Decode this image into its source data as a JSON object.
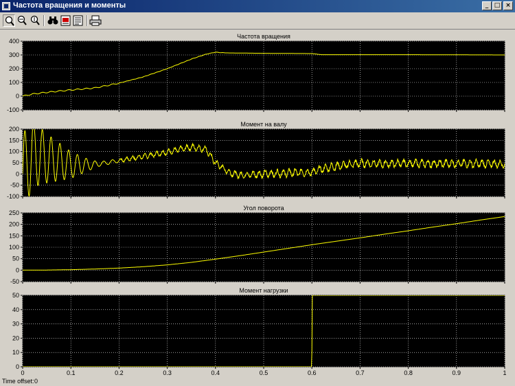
{
  "window": {
    "title": "Частота вращения и моменты",
    "minimize_icon": "minimize-icon",
    "maximize_icon": "maximize-icon",
    "close_icon": "close-icon"
  },
  "toolbar": {
    "tools": [
      "zoom-icon",
      "zoom-x-icon",
      "zoom-y-icon",
      "autoscale-binoculars-icon",
      "save-axes-settings-icon",
      "restore-axes-settings-icon",
      "print-icon"
    ]
  },
  "status": {
    "time_offset_label": "Time offset:",
    "time_offset_value": "0"
  },
  "colors": {
    "plot_background": "#000000",
    "signal": "#ffff00",
    "grid": "#ffffff",
    "figure_background": "#d4d0c8"
  },
  "chart_data": [
    {
      "type": "line",
      "title": "Частота вращения",
      "xlim": [
        0,
        1
      ],
      "ylim": [
        -100,
        400
      ],
      "xticks": [
        0,
        0.1,
        0.2,
        0.3,
        0.4,
        0.5,
        0.6,
        0.7,
        0.8,
        0.9,
        1
      ],
      "yticks": [
        -100,
        0,
        100,
        200,
        300,
        400
      ],
      "grid": true,
      "x": [
        0,
        0.02,
        0.05,
        0.1,
        0.15,
        0.2,
        0.25,
        0.3,
        0.35,
        0.38,
        0.4,
        0.42,
        0.5,
        0.6,
        0.62,
        0.7,
        0.8,
        0.9,
        1.0
      ],
      "y": [
        0,
        15,
        28,
        45,
        60,
        95,
        140,
        200,
        270,
        305,
        320,
        315,
        312,
        310,
        302,
        302,
        302,
        301,
        300
      ]
    },
    {
      "type": "line",
      "title": "Момент на валу",
      "xlim": [
        0,
        1
      ],
      "ylim": [
        -100,
        200
      ],
      "xticks": [
        0,
        0.1,
        0.2,
        0.3,
        0.4,
        0.5,
        0.6,
        0.7,
        0.8,
        0.9,
        1
      ],
      "yticks": [
        -100,
        -50,
        0,
        50,
        100,
        150,
        200
      ],
      "grid": true,
      "x": [
        0,
        0.02,
        0.05,
        0.1,
        0.14,
        0.16,
        0.2,
        0.25,
        0.3,
        0.35,
        0.38,
        0.4,
        0.43,
        0.45,
        0.5,
        0.55,
        0.6,
        0.62,
        0.65,
        0.7,
        0.75,
        0.8,
        0.85,
        0.9,
        0.95,
        1.0
      ],
      "y": [
        0,
        90,
        70,
        40,
        40,
        45,
        60,
        78,
        98,
        120,
        110,
        50,
        5,
        -5,
        0,
        5,
        8,
        22,
        35,
        48,
        45,
        48,
        46,
        47,
        46,
        45
      ],
      "osc_amplitude": [
        180,
        150,
        110,
        60,
        22,
        10,
        8,
        10,
        10,
        12,
        12,
        12,
        12,
        12,
        15,
        15,
        15,
        15,
        15,
        15,
        15,
        15,
        15,
        15,
        15,
        15
      ]
    },
    {
      "type": "line",
      "title": "Угол поворота",
      "xlim": [
        0,
        1
      ],
      "ylim": [
        -50,
        250
      ],
      "xticks": [
        0,
        0.1,
        0.2,
        0.3,
        0.4,
        0.5,
        0.6,
        0.7,
        0.8,
        0.9,
        1
      ],
      "yticks": [
        -50,
        0,
        50,
        100,
        150,
        200,
        250
      ],
      "grid": true,
      "x": [
        0,
        0.05,
        0.1,
        0.15,
        0.2,
        0.25,
        0.3,
        0.35,
        0.4,
        0.45,
        0.5,
        0.55,
        0.6,
        0.65,
        0.7,
        0.75,
        0.8,
        0.85,
        0.9,
        0.95,
        1.0
      ],
      "y": [
        0,
        0.5,
        2,
        5,
        9,
        15,
        23,
        34,
        48,
        63,
        79,
        95,
        111,
        126,
        141,
        157,
        172,
        188,
        203,
        219,
        234
      ]
    },
    {
      "type": "line",
      "title": "Момент нагрузки",
      "xlim": [
        0,
        1
      ],
      "ylim": [
        0,
        50
      ],
      "xticks": [
        0,
        0.1,
        0.2,
        0.3,
        0.4,
        0.5,
        0.6,
        0.7,
        0.8,
        0.9,
        1
      ],
      "xticklabels": [
        "0",
        "0.1",
        "0.2",
        "0.3",
        "0.4",
        "0.5",
        "0.6",
        "0.7",
        "0.8",
        "0.9",
        "1"
      ],
      "yticks": [
        0,
        10,
        20,
        30,
        40,
        50
      ],
      "grid": true,
      "x": [
        0,
        0.599,
        0.6,
        0.601,
        1.0
      ],
      "y": [
        0,
        0,
        10,
        50,
        50
      ]
    }
  ]
}
